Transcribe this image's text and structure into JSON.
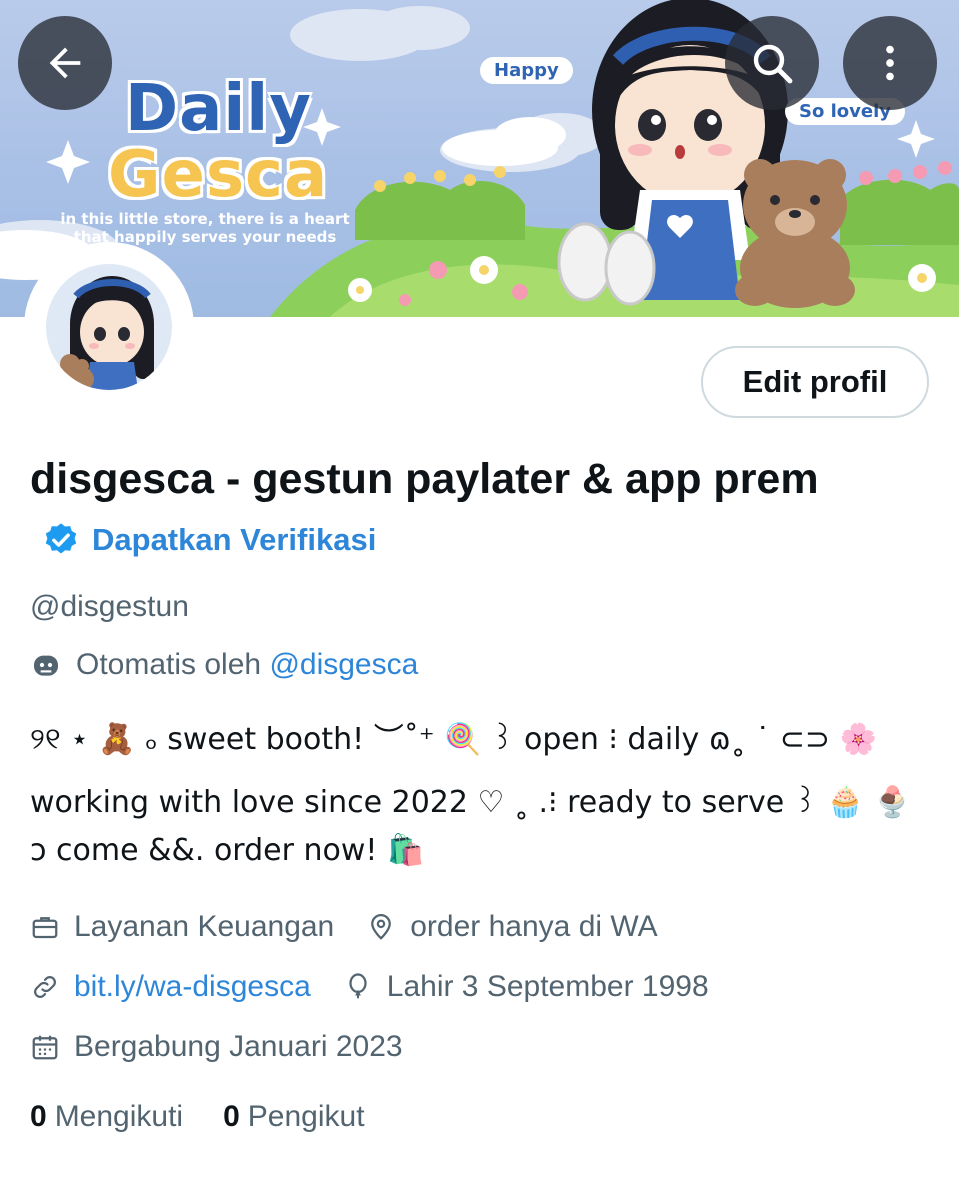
{
  "header": {
    "banner": {
      "brand_line1": "Daily",
      "brand_line2": "Gesca",
      "tagline": "in this little store, there is a heart that happily serves your needs",
      "pill_left": "Happy",
      "pill_right": "So lovely"
    },
    "back_icon": "arrow-left-icon",
    "search_icon": "search-icon",
    "more_icon": "more-vertical-icon",
    "avatar_caption": "disgesca"
  },
  "profile": {
    "edit_button": "Edit profil",
    "display_name": "disgesca - gestun paylater & app prem",
    "verify_link": "Dapatkan Verifikasi",
    "handle": "@disgestun",
    "automated_prefix": "Otomatis oleh",
    "automated_by": "@disgesca",
    "bio": {
      "line1": "୨୧ ⋆ 🧸 ₒ sweet booth! ︶˚⁺ 🍭 ꒱ open ⁝ daily ɷ˳ ˙ ⊂⊃ 🌸",
      "line2": "working with love since 2022 ♡ ˳ .⁝ ready to serve ꒱ 🧁 🍨",
      "line3": "ↄ come &&. order now! 🛍️"
    },
    "category": "Layanan Keuangan",
    "location": "order hanya di WA",
    "website": "bit.ly/wa-disgesca",
    "birthday": "Lahir 3 September 1998",
    "joined": "Bergabung Januari 2023",
    "following_count": "0",
    "following_label": "Mengikuti",
    "followers_count": "0",
    "followers_label": "Pengikut"
  },
  "colors": {
    "accent_blue": "#2e86d8",
    "muted_text": "#536471",
    "verified_badge": "#1d9bf0"
  }
}
